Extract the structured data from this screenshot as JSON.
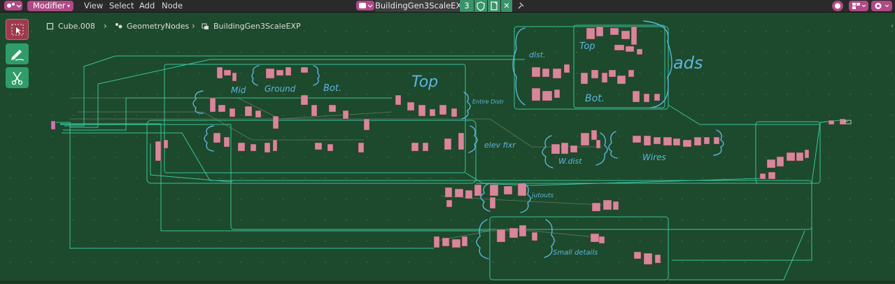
{
  "header": {
    "mode": "Modifier",
    "menus": [
      "View",
      "Select",
      "Add",
      "Node"
    ],
    "node_tree_name": "BuildingGen3ScaleEXP",
    "users_count": "3"
  },
  "breadcrumb": {
    "object": "Cube.008",
    "modifier": "GeometryNodes",
    "node_group": "BuildingGen3ScaleEXP"
  },
  "annotations": {
    "mid": "Mid",
    "ground": "Ground",
    "bot_left": "Bot.",
    "top_main": "Top",
    "entire_dist": "Entire Distr",
    "elev_fixr": "elev fixr",
    "w_dist": "W.dist",
    "wires": "Wires",
    "dist": "dist.",
    "top_ads": "Top",
    "bot_ads": "Bot.",
    "ads": "ads",
    "jutouts": "jutouts",
    "small_details": "Small details"
  },
  "colors": {
    "background": "#1d4a2c",
    "header": "#2a2a2a",
    "accent": "#b04a86",
    "frame_lines": "#3fd9b0",
    "node": "#d8869a",
    "annotation": "#5fb4e0",
    "tool_active": "#9c3a4e",
    "tool": "#2f9c6a"
  }
}
